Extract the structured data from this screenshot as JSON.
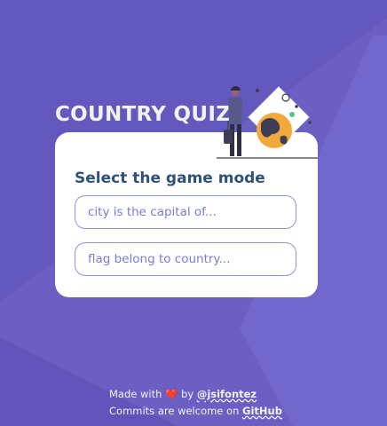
{
  "app": {
    "title": "COUNTRY QUIZ"
  },
  "card": {
    "heading": "Select the game mode",
    "options": [
      {
        "label": "city is the capital of..."
      },
      {
        "label": "flag belong to country..."
      }
    ]
  },
  "footer": {
    "made_prefix": "Made with",
    "heart": "❤️",
    "by": "by",
    "author": "@jsifontez",
    "commits_text": "Commits are welcome on",
    "repo_link": "GitHub"
  },
  "colors": {
    "background": "#6b5fc4",
    "accent": "#6066d0",
    "heading": "#2f527b"
  }
}
